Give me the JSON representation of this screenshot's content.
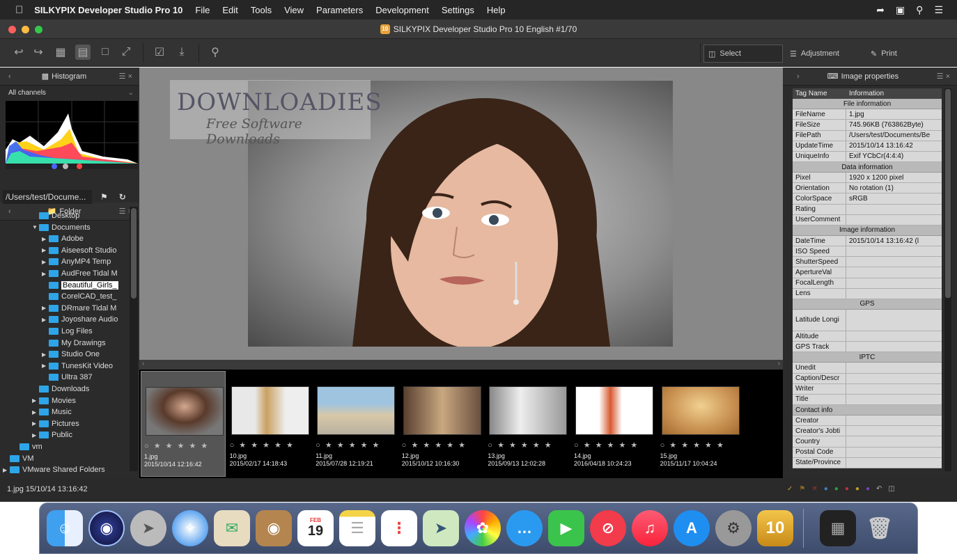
{
  "menubar": {
    "apple": "",
    "app_name": "SILKYPIX Developer Studio Pro 10",
    "items": [
      "File",
      "Edit",
      "Tools",
      "View",
      "Parameters",
      "Development",
      "Settings",
      "Help"
    ]
  },
  "window": {
    "title": "SILKYPIX Developer Studio Pro 10 English  #1/70",
    "badge": "10"
  },
  "toolbar": {
    "select_label": "Select",
    "adjustment_label": "Adjustment",
    "print_label": "Print"
  },
  "histogram": {
    "title": "Histogram",
    "channel": "All channels"
  },
  "folder": {
    "title": "Folder",
    "path": "/Users/test/Docume..."
  },
  "tree": [
    {
      "label": "Desktop",
      "indent": 4,
      "arrow": ""
    },
    {
      "label": "Documents",
      "indent": 4,
      "arrow": "▼"
    },
    {
      "label": "Adobe",
      "indent": 5,
      "arrow": "▶"
    },
    {
      "label": "Aiseesoft Studio",
      "indent": 5,
      "arrow": "▶"
    },
    {
      "label": "AnyMP4 Temp",
      "indent": 5,
      "arrow": "▶"
    },
    {
      "label": "AudFree Tidal M",
      "indent": 5,
      "arrow": "▶"
    },
    {
      "label": "Beautiful_Girls_",
      "indent": 5,
      "arrow": "",
      "selected": true
    },
    {
      "label": "CorelCAD_test_",
      "indent": 5,
      "arrow": ""
    },
    {
      "label": "DRmare Tidal M",
      "indent": 5,
      "arrow": "▶"
    },
    {
      "label": "Joyoshare Audio",
      "indent": 5,
      "arrow": "▶"
    },
    {
      "label": "Log Files",
      "indent": 5,
      "arrow": ""
    },
    {
      "label": "My Drawings",
      "indent": 5,
      "arrow": ""
    },
    {
      "label": "Studio One",
      "indent": 5,
      "arrow": "▶"
    },
    {
      "label": "TunesKit Video",
      "indent": 5,
      "arrow": "▶"
    },
    {
      "label": "Ultra 387",
      "indent": 5,
      "arrow": ""
    },
    {
      "label": "Downloads",
      "indent": 4,
      "arrow": ""
    },
    {
      "label": "Movies",
      "indent": 4,
      "arrow": "▶"
    },
    {
      "label": "Music",
      "indent": 4,
      "arrow": "▶"
    },
    {
      "label": "Pictures",
      "indent": 4,
      "arrow": "▶"
    },
    {
      "label": "Public",
      "indent": 4,
      "arrow": "▶"
    },
    {
      "label": "vm",
      "indent": 2,
      "arrow": ""
    },
    {
      "label": "VM",
      "indent": 1,
      "arrow": ""
    },
    {
      "label": "VMware Shared Folders",
      "indent": 1,
      "arrow": "▶"
    }
  ],
  "watermark": {
    "title": "DOWNLOADIES",
    "subtitle": "Free Software Downloads"
  },
  "filmstrip": [
    {
      "name": "1.jpg",
      "date": "2015/10/14 12:16:42",
      "stars": "○ ★ ★ ★ ★ ★"
    },
    {
      "name": "10.jpg",
      "date": "2015/02/17 14:18:43",
      "stars": "○ ★ ★ ★ ★ ★"
    },
    {
      "name": "11.jpg",
      "date": "2015/07/28 12:19:21",
      "stars": "○ ★ ★ ★ ★ ★"
    },
    {
      "name": "12.jpg",
      "date": "2015/10/12 10:16:30",
      "stars": "○ ★ ★ ★ ★ ★"
    },
    {
      "name": "13.jpg",
      "date": "2015/09/13 12:02:28",
      "stars": "○ ★ ★ ★ ★ ★"
    },
    {
      "name": "14.jpg",
      "date": "2016/04/18 10:24:23",
      "stars": "○ ★ ★ ★ ★ ★"
    },
    {
      "name": "15.jpg",
      "date": "2015/11/17 10:04:24",
      "stars": "○ ★ ★ ★ ★ ★"
    }
  ],
  "image_properties": {
    "title": "Image properties",
    "col_tag": "Tag Name",
    "col_info": "Information",
    "rows": [
      {
        "section": "File information"
      },
      {
        "k": "FileName",
        "v": "1.jpg"
      },
      {
        "k": "FileSize",
        "v": "745.96KB (763862Byte)"
      },
      {
        "k": "FilePath",
        "v": "/Users/test/Documents/Be"
      },
      {
        "k": "UpdateTime",
        "v": "2015/10/14 13:16:42"
      },
      {
        "k": "UniqueInfo",
        "v": "Exif YCbCr(4:4:4)"
      },
      {
        "section": "Data information"
      },
      {
        "k": "Pixel",
        "v": "1920 x 1200 pixel"
      },
      {
        "k": "Orientation",
        "v": "No rotation (1)"
      },
      {
        "k": "ColorSpace",
        "v": "sRGB"
      },
      {
        "k": "Rating",
        "v": ""
      },
      {
        "k": "UserComment",
        "v": ""
      },
      {
        "section": "Image information"
      },
      {
        "k": "DateTime",
        "v": "2015/10/14 13:16:42 (l"
      },
      {
        "k": "ISO Speed",
        "v": ""
      },
      {
        "k": "ShutterSpeed",
        "v": ""
      },
      {
        "k": "ApertureVal",
        "v": ""
      },
      {
        "k": "FocalLength",
        "v": ""
      },
      {
        "k": "Lens",
        "v": ""
      },
      {
        "section": "GPS"
      },
      {
        "k": "Latitude Longi",
        "v": "",
        "tall": true
      },
      {
        "k": "Altitude",
        "v": ""
      },
      {
        "k": "GPS Track",
        "v": ""
      },
      {
        "section": "IPTC"
      },
      {
        "k": "Unedit",
        "v": ""
      },
      {
        "k": "Caption/Descr",
        "v": ""
      },
      {
        "k": "Writer",
        "v": ""
      },
      {
        "k": "Title",
        "v": ""
      },
      {
        "section_left": "Contact info"
      },
      {
        "k": "Creator",
        "v": ""
      },
      {
        "k": "Creator's Jobti",
        "v": ""
      },
      {
        "k": "Country",
        "v": ""
      },
      {
        "k": "Postal Code",
        "v": ""
      },
      {
        "k": "State/Province",
        "v": ""
      }
    ]
  },
  "status": {
    "text": "1.jpg 15/10/14 13:16:42"
  },
  "dock": {
    "calendar_month": "FEB",
    "calendar_day": "19",
    "app_badge": "10"
  }
}
